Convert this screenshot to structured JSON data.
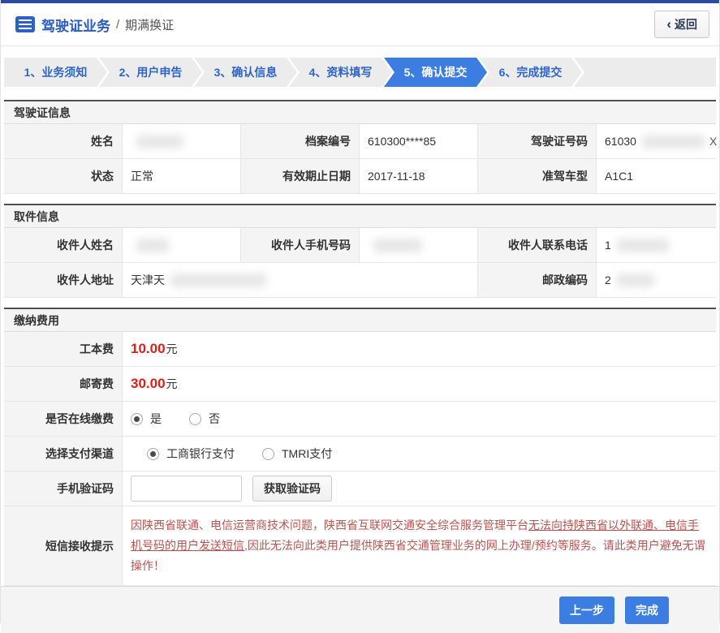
{
  "header": {
    "title": "驾驶证业务",
    "divider": "/",
    "subtitle": "期满换证",
    "back_chevron": "‹",
    "back_label": "返回"
  },
  "steps": [
    {
      "label": "1、业务须知",
      "active": false
    },
    {
      "label": "2、用户申告",
      "active": false
    },
    {
      "label": "3、确认信息",
      "active": false
    },
    {
      "label": "4、资料填写",
      "active": false
    },
    {
      "label": "5、确认提交",
      "active": true
    },
    {
      "label": "6、完成提交",
      "active": false
    }
  ],
  "license": {
    "title": "驾驶证信息",
    "rows": [
      {
        "c1": {
          "label": "姓名",
          "value": "",
          "masked": true
        },
        "c2": {
          "label": "档案编号",
          "value": "610300****85"
        },
        "c3": {
          "label": "驾驶证号码",
          "value": "61030",
          "masked": true,
          "suffix": "X"
        }
      },
      {
        "c1": {
          "label": "状态",
          "value": "正常"
        },
        "c2": {
          "label": "有效期止日期",
          "value": "2017-11-18"
        },
        "c3": {
          "label": "准驾车型",
          "value": "A1C1"
        }
      }
    ]
  },
  "pickup": {
    "title": "取件信息",
    "rows": [
      {
        "c1": {
          "label": "收件人姓名",
          "value": "",
          "masked": true
        },
        "c2": {
          "label": "收件人手机号码",
          "value": "",
          "masked": true
        },
        "c3": {
          "label": "收件人联系电话",
          "value": "1",
          "masked": true
        }
      },
      {
        "c1": {
          "label": "收件人地址",
          "value": "天津天",
          "masked": true
        },
        "c3": {
          "label": "邮政编码",
          "value": "2",
          "masked": true
        }
      }
    ]
  },
  "fees": {
    "title": "缴纳费用",
    "work_fee": {
      "label": "工本费",
      "amount": "10.00",
      "unit": "元"
    },
    "post_fee": {
      "label": "邮寄费",
      "amount": "30.00",
      "unit": "元"
    },
    "online_pay": {
      "label": "是否在线缴费",
      "options": [
        {
          "label": "是",
          "checked": true
        },
        {
          "label": "否",
          "checked": false
        }
      ]
    },
    "channel": {
      "label": "选择支付渠道",
      "options": [
        {
          "label": "工商银行支付",
          "checked": true
        },
        {
          "label": "TMRI支付",
          "checked": false
        }
      ]
    },
    "sms_code": {
      "label": "手机验证码",
      "input_value": "",
      "button": "获取验证码"
    },
    "notice": {
      "label": "短信接收提示",
      "part1": "因陕西省联通、电信运营商技术问题，陕西省互联网交通安全综合服务管理平台",
      "part2": "无法向持陕西省以外联通、电信手机号码的用户发送短信",
      "part3": ",因此无法向此类用户提供陕西省交通管理业务的网上办理/预约等服务。请此类用户避免无谓操作！"
    }
  },
  "footer": {
    "prev_button": "上一步",
    "finish_button": "完成"
  },
  "colors": {
    "top_bar_blue": "#2b4a9e",
    "accent_blue": "#3c7de2",
    "step_text_blue": "#2f64c9",
    "fee_red": "#d9201c",
    "notice_red": "#b85450"
  }
}
